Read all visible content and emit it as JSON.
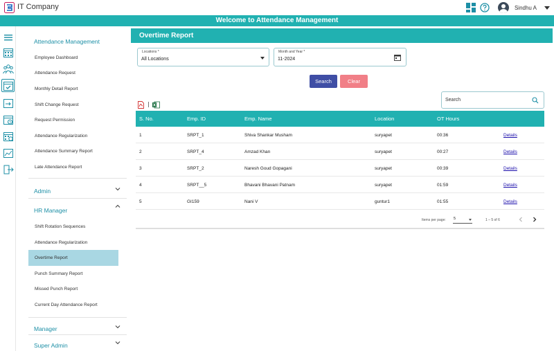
{
  "app": {
    "company": "IT Company",
    "welcome": "Welcome to Attendance Management"
  },
  "header": {
    "username": "Sindhu A"
  },
  "sidebar": {
    "section_attendance": "Attendance Management",
    "attendance_items": [
      "Employee Dashboard",
      "Attendance Request",
      "Monthly Detail Report",
      "Shift Change Request",
      "Request Permission",
      "Attendance Regularization",
      "Attendance Summary Report",
      "Late Attendance Report"
    ],
    "section_admin": "Admin",
    "section_hr": "HR Manager",
    "hr_items": [
      "Shift Rotation Sequences",
      "Attendance Regularization",
      "Overtime Report",
      "Punch Summary Report",
      "Missed Punch Report",
      "Current Day Attendance Report"
    ],
    "section_manager": "Manager",
    "section_super_admin": "Super Admin"
  },
  "page": {
    "title": "Overtime Report",
    "locations_label": "Locations *",
    "locations_value": "All Locations",
    "month_label": "Month and Year *",
    "month_value": "11-2024",
    "search_button": "Search",
    "clear_button": "Clear",
    "search_placeholder": "Search"
  },
  "table": {
    "headers": [
      "S. No.",
      "Emp. ID",
      "Emp. Name",
      "Location",
      "OT Hours"
    ],
    "rows": [
      {
        "sno": "1",
        "emp_id": "SRPT_1",
        "name": "Shiva Shankar Musham",
        "location": "suryapet",
        "ot": "00:36",
        "action": "Details"
      },
      {
        "sno": "2",
        "emp_id": "SRPT_4",
        "name": "Amzad Khan",
        "location": "suryapet",
        "ot": "00:27",
        "action": "Details"
      },
      {
        "sno": "3",
        "emp_id": "SRPT_2",
        "name": "Naresh Goud Gopagani",
        "location": "suryapet",
        "ot": "00:39",
        "action": "Details"
      },
      {
        "sno": "4",
        "emp_id": "SRPT__5",
        "name": "Bhavani Bhavani Patnam",
        "location": "suryapet",
        "ot": "01:59",
        "action": "Details"
      },
      {
        "sno": "5",
        "emp_id": "GI159",
        "name": "Nani V",
        "location": "guntur1",
        "ot": "01:55",
        "action": "Details"
      }
    ]
  },
  "paginator": {
    "items_label": "Items per page:",
    "page_size": "5",
    "range": "1 – 5 of 6"
  },
  "colors": {
    "teal": "#21b1b1",
    "accent": "#1d8fa6",
    "search_btn": "#3f4ea5",
    "clear_btn": "#f17f87",
    "active_menu": "#a9d7e3"
  },
  "icons": [
    "menu-icon",
    "calendar-grid-icon",
    "team-icon",
    "calendar-check-icon",
    "shift-swap-icon",
    "schedule-icon",
    "calendar-clock-icon",
    "chart-icon",
    "logout-icon",
    "dashboard-icon",
    "help-icon",
    "user-avatar-icon",
    "pdf-icon",
    "excel-icon",
    "search-icon"
  ]
}
